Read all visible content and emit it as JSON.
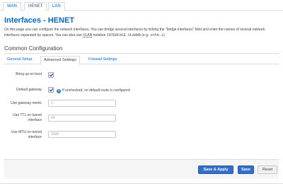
{
  "top_tabs": [
    "WAN",
    "HENET",
    "LAN"
  ],
  "page": {
    "title": "Interfaces - HENET",
    "desc_part1": "On this page you can configure the network interfaces. You can bridge several interfaces by ticking the \"bridge interfaces\" field and enter the names of several network interfaces separated by spaces. You can also use ",
    "desc_vlan": "VLAN",
    "desc_part2": " notation ",
    "desc_mono": "INTERFACE.VLANNR",
    "desc_part3": " (e.g.: ",
    "desc_example": "eth0.1",
    "desc_part4": ")."
  },
  "section": {
    "title": "Common Configuration",
    "tabs": [
      "General Setup",
      "Advanced Settings",
      "Firewall Settings"
    ],
    "active_tab": "Advanced Settings"
  },
  "form": {
    "bring_up_on_boot": {
      "label": "Bring up on boot",
      "checked": true
    },
    "default_gateway": {
      "label": "Default gateway",
      "checked": true,
      "hint": "If unchecked, no default route is configured"
    },
    "gateway_metric": {
      "label": "Use gateway metric",
      "value": "",
      "placeholder": "1"
    },
    "ttl_tunnel": {
      "label": "Use TTL on tunnel interface",
      "value": "",
      "placeholder": "64"
    },
    "mtu_tunnel": {
      "label": "Use MTU on tunnel interface",
      "value": "",
      "placeholder": "1500"
    }
  },
  "footer": {
    "save_apply_label": "Save & Apply",
    "save_label": "Save",
    "reset_label": "Reset"
  },
  "icons": {
    "info": "info-icon",
    "checkbox": "checkbox-checked"
  },
  "colors": {
    "link": "#0069d6",
    "primary_button": "#2f6fcf",
    "footer_bg": "#f5f5f5"
  }
}
